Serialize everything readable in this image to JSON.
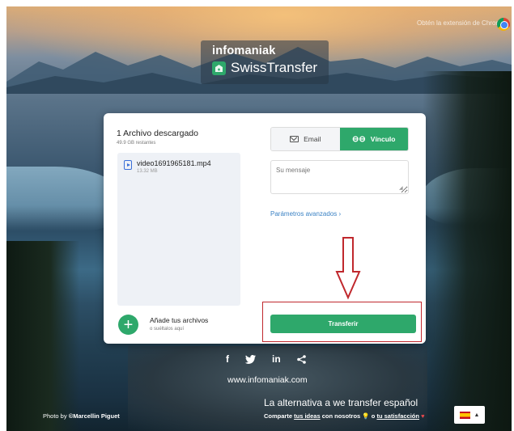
{
  "browser": {
    "hint_text": "Obtén la extensión de Chrome",
    "chrome_icon": "chrome-logo-icon"
  },
  "brand": {
    "company": "infomaniak",
    "product": "SwissTransfer",
    "icon": "swisstransfer-logo-icon"
  },
  "files": {
    "title": "1 Archivo descargado",
    "remaining": "49.9 GB restantes",
    "items": [
      {
        "name": "video1691965181.mp4",
        "size": "13.32 MB",
        "icon": "video-file-icon"
      }
    ],
    "add_title": "Añade tus archivos",
    "add_subtitle": "o suéltalos aquí",
    "add_icon": "plus-icon"
  },
  "transfer": {
    "tab_email": "Email",
    "tab_link": "Vínculo",
    "active_tab": "Vínculo",
    "message_placeholder": "Su mensaje",
    "advanced_label": "Parámetros avanzados",
    "submit_label": "Transferir"
  },
  "footer": {
    "social": [
      "f",
      "in"
    ],
    "url": "www.infomaniak.com",
    "tagline": "La alternativa a we transfer español",
    "share_prefix": "Comparte",
    "share_ideas": "tus ideas",
    "share_middle": "con nosotros",
    "share_or": "o",
    "share_satisfaction": "tu satisfacción",
    "photo_prefix": "Photo by ",
    "photo_author": "©Marcellin Piguet",
    "language_arrow": "▲"
  },
  "colors": {
    "accent": "#2ea86b",
    "annotation": "#c0282d",
    "link": "#3b82c4"
  }
}
